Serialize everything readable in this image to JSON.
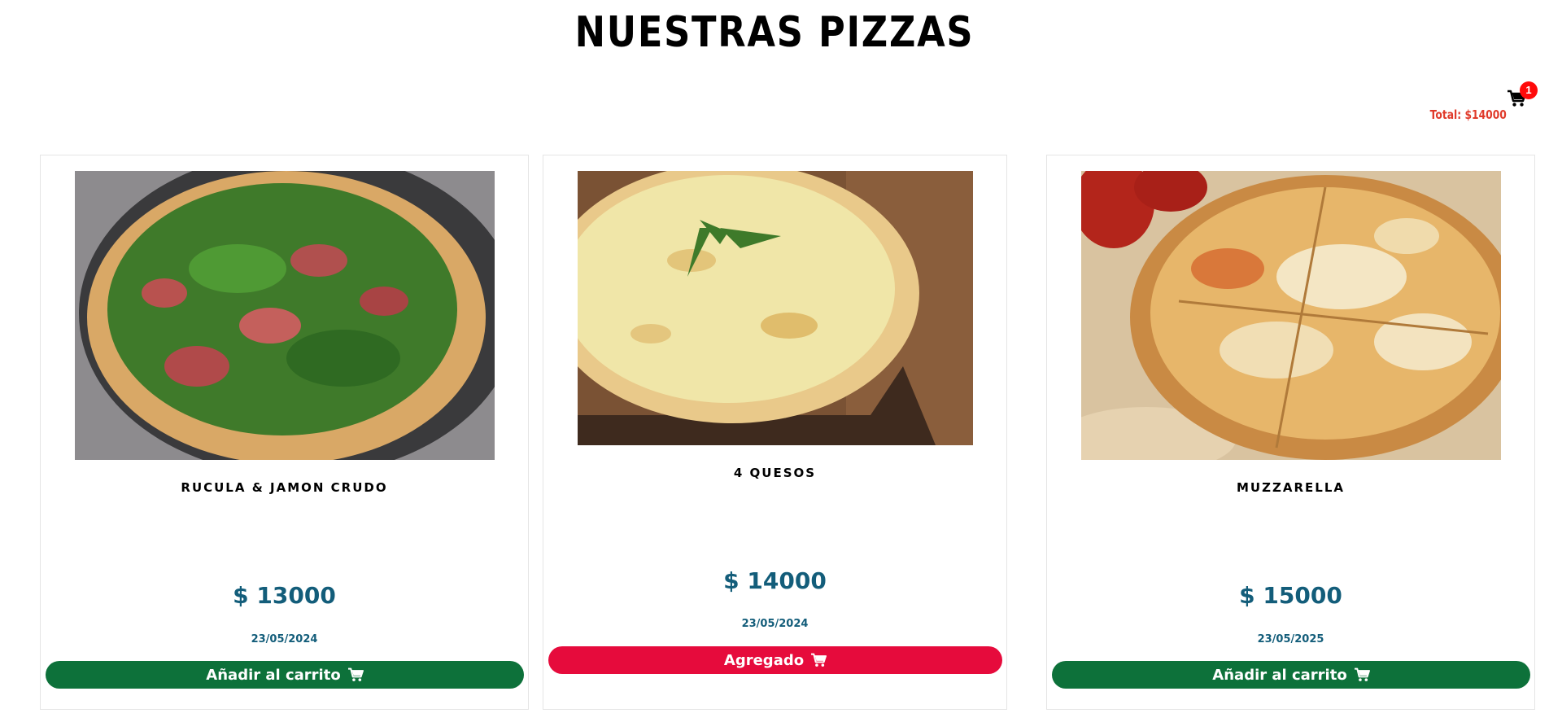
{
  "header": {
    "title": "NUESTRAS PIZZAS"
  },
  "cart": {
    "count": "1",
    "total": "Total: $14000",
    "icon": "shopping-cart-icon"
  },
  "products": [
    {
      "name": "RUCULA & JAMON CRUDO",
      "price": "$ 13000",
      "date": "23/05/2024",
      "button_label": "Añadir al carrito",
      "button_state": "add",
      "image": "pizza-rucula-jamon-image"
    },
    {
      "name": "4 QUESOS",
      "price": "$ 14000",
      "date": "23/05/2024",
      "button_label": "Agregado",
      "button_state": "added",
      "image": "pizza-4-quesos-image"
    },
    {
      "name": "MUZZARELLA",
      "price": "$ 15000",
      "date": "23/05/2025",
      "button_label": "Añadir al carrito",
      "button_state": "add",
      "image": "pizza-muzzarella-image"
    }
  ],
  "colors": {
    "add_button": "#0d713a",
    "added_button": "#e60b3c",
    "price": "#135d7a",
    "total": "#e03a2a",
    "badge": "#ff0a0a"
  }
}
